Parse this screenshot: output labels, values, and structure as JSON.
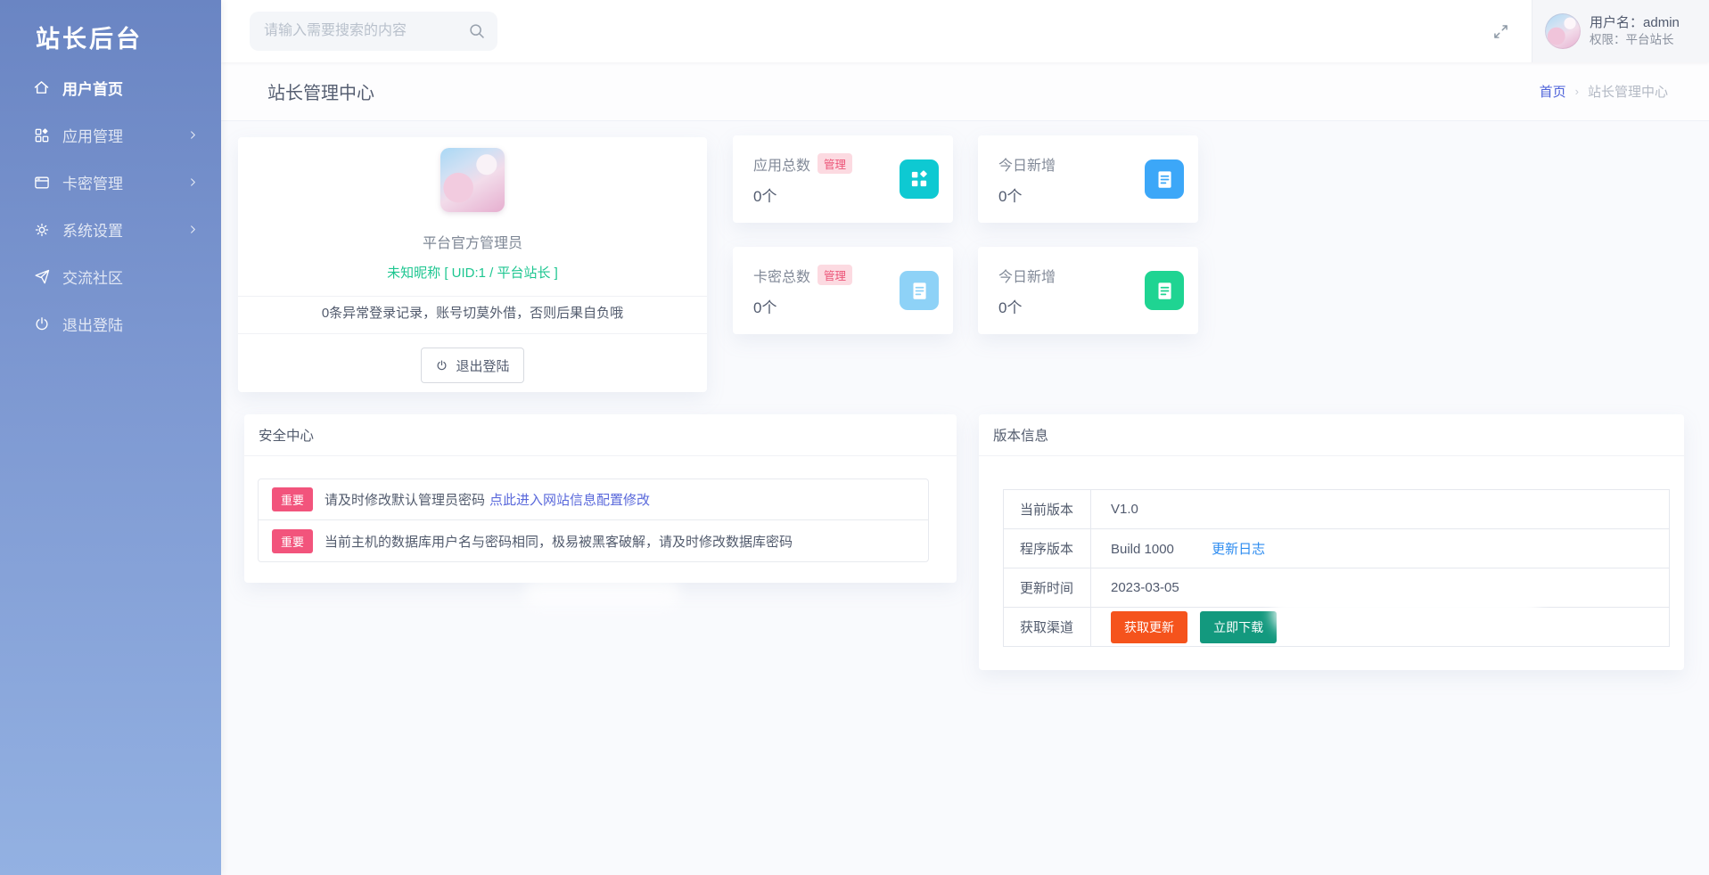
{
  "app": {
    "title": "站长后台"
  },
  "sidebar": {
    "items": [
      {
        "label": "用户首页",
        "icon": "home-icon",
        "active": true
      },
      {
        "label": "应用管理",
        "icon": "apps-icon",
        "has_children": true
      },
      {
        "label": "卡密管理",
        "icon": "card-window-icon",
        "has_children": true
      },
      {
        "label": "系统设置",
        "icon": "gear-icon",
        "has_children": true
      },
      {
        "label": "交流社区",
        "icon": "paper-plane-icon"
      },
      {
        "label": "退出登陆",
        "icon": "power-icon"
      }
    ]
  },
  "topbar": {
    "search_placeholder": "请输入需要搜索的内容",
    "username_label": "用户名：",
    "username": "admin",
    "role_label": "权限：",
    "role": "平台站长"
  },
  "page": {
    "title": "站长管理中心",
    "breadcrumb_home": "首页",
    "separator": "›",
    "breadcrumb_current": "站长管理中心"
  },
  "profile": {
    "role_title": "平台官方管理员",
    "nickname_line": "未知昵称 [ UID:1 / 平台站长 ]",
    "notice": "0条异常登录记录，账号切莫外借，否则后果自负哦",
    "logout_label": "退出登陆"
  },
  "stats": [
    {
      "label": "应用总数",
      "badge": "管理",
      "value": "0个",
      "icon": "apps-grid-icon",
      "icon_color": "#0ec9d2",
      "icon_style": "background:#0ec9d2;color:#0ec9d2"
    },
    {
      "label": "今日新增",
      "value": "0个",
      "icon": "document-icon",
      "icon_color": "#3ca7f8",
      "icon_style": "background:#3ca7f8;color:#3ca7f8"
    },
    {
      "label": "卡密总数",
      "badge": "管理",
      "value": "0个",
      "icon": "document-icon",
      "icon_color": "#8ed2f7",
      "icon_style": "background:#8ed2f7;color:#8ed2f7"
    },
    {
      "label": "今日新增",
      "value": "0个",
      "icon": "document-icon",
      "icon_color": "#1fd492",
      "icon_style": "background:#1fd492;color:#1fd492"
    }
  ],
  "security": {
    "title": "安全中心",
    "items": [
      {
        "badge": "重要",
        "text": "请及时修改默认管理员密码",
        "link": "点此进入网站信息配置修改"
      },
      {
        "badge": "重要",
        "text": "当前主机的数据库用户名与密码相同，极易被黑客破解，请及时修改数据库密码"
      }
    ]
  },
  "version": {
    "title": "版本信息",
    "rows": [
      {
        "label": "当前版本",
        "value": "V1.0"
      },
      {
        "label": "程序版本",
        "value": "Build 1000",
        "link": "更新日志"
      },
      {
        "label": "更新时间",
        "value": "2023-03-05"
      },
      {
        "label": "获取渠道",
        "btn_update": "获取更新",
        "btn_download": "立即下载"
      }
    ]
  },
  "colors": {
    "sidebar_top": "#6a85c3",
    "sidebar_bottom": "#93b1e2",
    "link_blue": "#2d8cf0",
    "link_indigo": "#5968db",
    "green_text": "#1dc690",
    "badge_pink_bg": "#fcdae1",
    "badge_pink_text": "#ec5578",
    "important_badge": "#f2547c",
    "btn_orange": "#f5531c",
    "btn_teal": "#13997e"
  }
}
